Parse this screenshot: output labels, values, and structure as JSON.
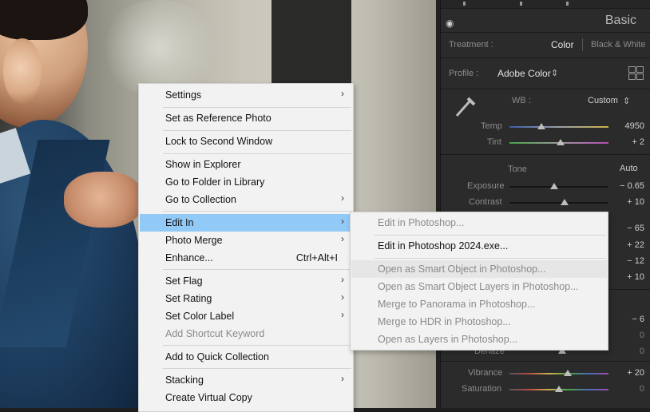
{
  "context_menu": {
    "items": [
      {
        "label": "Settings",
        "submenu": true
      },
      {
        "label": "Set as Reference Photo"
      },
      {
        "label": "Lock to Second Window"
      },
      {
        "label": "Show in Explorer"
      },
      {
        "label": "Go to Folder in Library"
      },
      {
        "label": "Go to Collection",
        "submenu": true
      },
      {
        "label": "Edit In",
        "submenu": true,
        "highlighted": true
      },
      {
        "label": "Photo Merge",
        "submenu": true
      },
      {
        "label": "Enhance...",
        "shortcut": "Ctrl+Alt+I"
      },
      {
        "label": "Set Flag",
        "submenu": true
      },
      {
        "label": "Set Rating",
        "submenu": true
      },
      {
        "label": "Set Color Label",
        "submenu": true
      },
      {
        "label": "Add Shortcut Keyword",
        "disabled": true
      },
      {
        "label": "Add to Quick Collection"
      },
      {
        "label": "Stacking",
        "submenu": true
      },
      {
        "label": "Create Virtual Copy"
      }
    ]
  },
  "edit_in_submenu": {
    "items": [
      {
        "label": "Edit in Photoshop...",
        "disabled": true
      },
      {
        "label": "Edit in Photoshop 2024.exe...",
        "disabled": false
      },
      {
        "label": "Open as Smart Object in Photoshop...",
        "disabled": true
      },
      {
        "label": "Open as Smart Object Layers in Photoshop...",
        "disabled": true
      },
      {
        "label": "Merge to Panorama in Photoshop...",
        "disabled": true
      },
      {
        "label": "Merge to HDR in Photoshop...",
        "disabled": true
      },
      {
        "label": "Open as Layers in Photoshop...",
        "disabled": true
      }
    ]
  },
  "develop_panel": {
    "title": "Basic",
    "treatment_label": "Treatment :",
    "treatment_color": "Color",
    "treatment_bw": "Black & White",
    "profile_label": "Profile :",
    "profile_value": "Adobe Color",
    "wb_label": "WB :",
    "wb_value": "Custom",
    "temp": {
      "label": "Temp",
      "value": "4950"
    },
    "tint": {
      "label": "Tint",
      "value": "+ 2"
    },
    "tone_label": "Tone",
    "auto_label": "Auto",
    "exposure": {
      "label": "Exposure",
      "value": "− 0.65"
    },
    "contrast": {
      "label": "Contrast",
      "value": "+ 10"
    },
    "hidden_values": [
      "− 65",
      "+ 22",
      "− 12",
      "+ 10",
      "− 6",
      "0",
      "0"
    ],
    "dehaze_label": "Dehaze",
    "vibrance": {
      "label": "Vibrance",
      "value": "+ 20"
    },
    "saturation": {
      "label": "Saturation",
      "value": "0"
    }
  },
  "colors": {
    "menu_highlight": "#91c9f7",
    "panel_bg": "#2b2b2b"
  }
}
